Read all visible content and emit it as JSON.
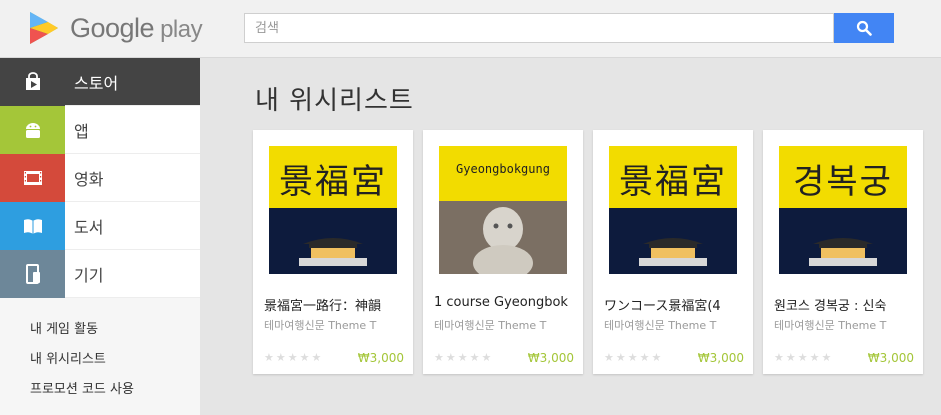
{
  "header": {
    "logo_text": "Google",
    "logo_play": "play",
    "search_placeholder": "검색"
  },
  "sidebar": {
    "nav": [
      {
        "label": "스토어",
        "icon": "shopping-bag-icon"
      },
      {
        "label": "앱",
        "icon": "android-icon"
      },
      {
        "label": "영화",
        "icon": "film-icon"
      },
      {
        "label": "도서",
        "icon": "book-icon"
      },
      {
        "label": "기기",
        "icon": "devices-icon"
      }
    ],
    "links": [
      "내 게임 활동",
      "내 위시리스트",
      "프로모션 코드 사용"
    ]
  },
  "main": {
    "title": "내 위시리스트",
    "cards": [
      {
        "cover_text": "景福宮",
        "title": "景福宮一路行：神韻",
        "subtitle": "테마여행신문 Theme T",
        "price": "₩3,000",
        "stars": "★★★★★"
      },
      {
        "cover_text": "Gyeongbokgung",
        "title": "1 course Gyeongbok",
        "subtitle": "테마여행신문 Theme T",
        "price": "₩3,000",
        "stars": "★★★★★"
      },
      {
        "cover_text": "景福宮",
        "title": "ワンコース景福宮(4",
        "subtitle": "테마여행신문 Theme T",
        "price": "₩3,000",
        "stars": "★★★★★"
      },
      {
        "cover_text": "경복궁",
        "title": "원코스 경복궁 : 신숙",
        "subtitle": "테마여행신문 Theme T",
        "price": "₩3,000",
        "stars": "★★★★★"
      }
    ]
  },
  "colors": {
    "accent": "#4285f4",
    "price": "#a4c639",
    "active_nav": "#444444"
  }
}
